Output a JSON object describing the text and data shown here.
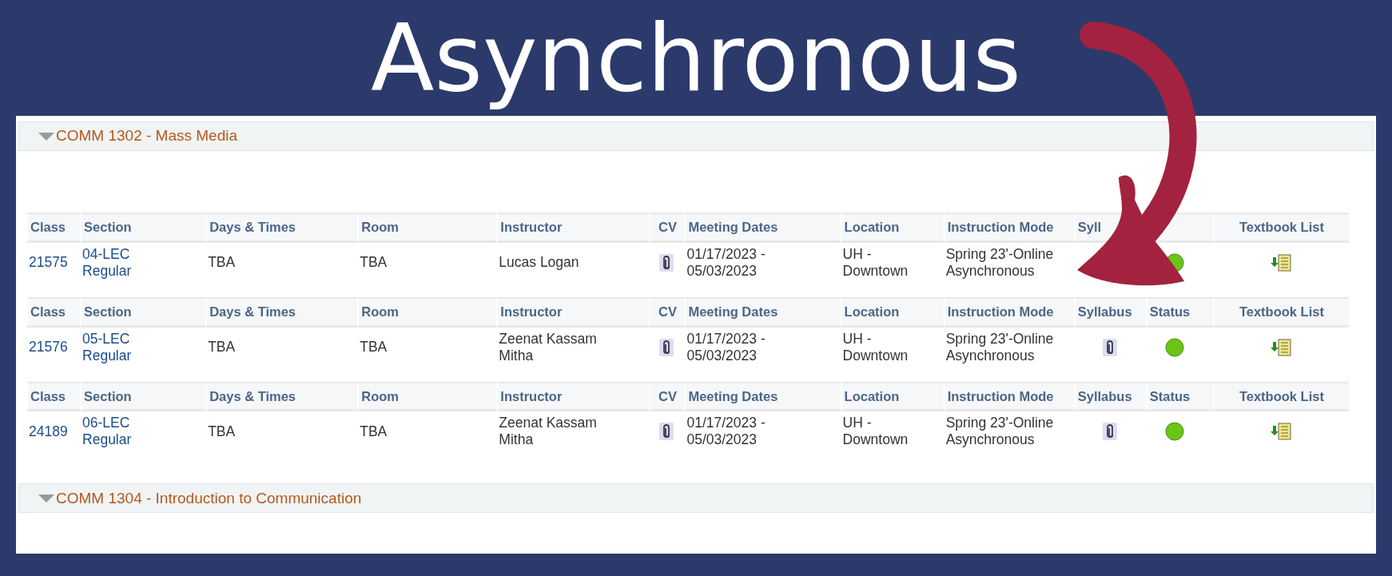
{
  "title": "Asynchronous",
  "courses": [
    {
      "title": "COMM 1302 - Mass Media",
      "expanded": true,
      "sections": [
        {
          "columns": [
            "Class",
            "Section",
            "Days & Times",
            "Room",
            "Instructor",
            "CV",
            "Meeting Dates",
            "Location",
            "Instruction Mode",
            "Syll",
            null,
            "Textbook List"
          ],
          "class": "21575",
          "section": "04-LEC Regular",
          "days_times": "TBA",
          "room": "TBA",
          "instructor": "Lucas Logan",
          "cv": true,
          "meeting_dates": "01/17/2023 - 05/03/2023",
          "location": "UH - Downtown",
          "instruction_mode": "Spring 23'-Online Asynchronous",
          "status_open": true,
          "textbook_list": true
        },
        {
          "columns": [
            "Class",
            "Section",
            "Days & Times",
            "Room",
            "Instructor",
            "CV",
            "Meeting Dates",
            "Location",
            "Instruction Mode",
            "Syllabus",
            "Status",
            "Textbook List"
          ],
          "class": "21576",
          "section": "05-LEC Regular",
          "days_times": "TBA",
          "room": "TBA",
          "instructor": "Zeenat Kassam Mitha",
          "cv": true,
          "meeting_dates": "01/17/2023 - 05/03/2023",
          "location": "UH - Downtown",
          "instruction_mode": "Spring 23'-Online Asynchronous",
          "syllabus": true,
          "status_open": true,
          "textbook_list": true
        },
        {
          "columns": [
            "Class",
            "Section",
            "Days & Times",
            "Room",
            "Instructor",
            "CV",
            "Meeting Dates",
            "Location",
            "Instruction Mode",
            "Syllabus",
            "Status",
            "Textbook List"
          ],
          "class": "24189",
          "section": "06-LEC Regular",
          "days_times": "TBA",
          "room": "TBA",
          "instructor": "Zeenat Kassam Mitha",
          "cv": true,
          "meeting_dates": "01/17/2023 - 05/03/2023",
          "location": "UH - Downtown",
          "instruction_mode": "Spring 23'-Online Asynchronous",
          "syllabus": true,
          "status_open": true,
          "textbook_list": true
        }
      ]
    },
    {
      "title": "COMM 1304 - Introduction to Communication",
      "expanded": true
    }
  ]
}
